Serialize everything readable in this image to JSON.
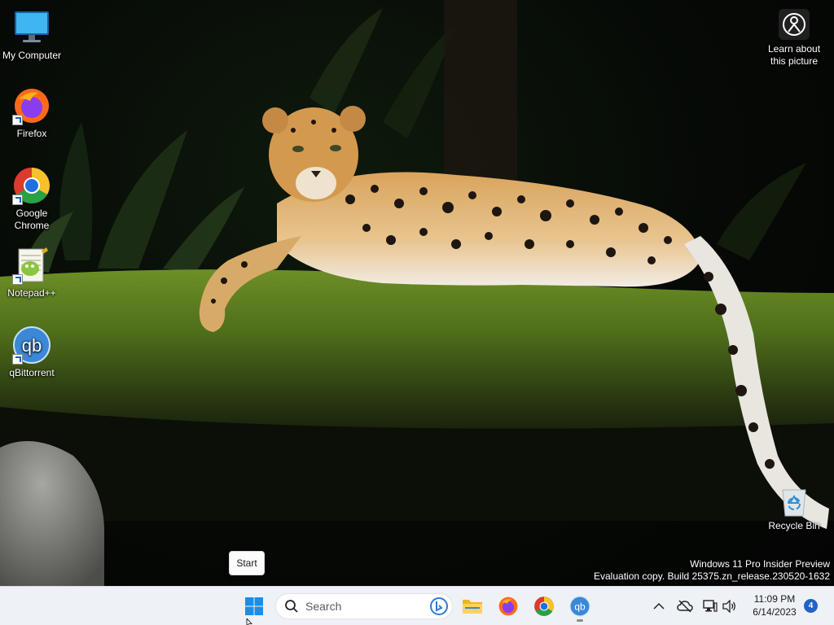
{
  "desktop": {
    "icons": [
      {
        "label": "My Computer",
        "icon": "monitor-icon"
      },
      {
        "label": "Firefox",
        "icon": "firefox-icon"
      },
      {
        "label": "Google Chrome",
        "icon": "chrome-icon"
      },
      {
        "label": "Notepad++",
        "icon": "notepadpp-icon"
      },
      {
        "label": "qBittorrent",
        "icon": "qbittorrent-icon"
      }
    ],
    "spotlight_label": "Learn about this picture",
    "recycle_bin_label": "Recycle Bin",
    "qb_glyph": "qb"
  },
  "watermark": {
    "line1": "Windows 11 Pro Insider Preview",
    "line2": "Evaluation copy. Build 25375.zn_release.230520-1632"
  },
  "tooltip": {
    "text": "Start"
  },
  "taskbar": {
    "search_placeholder": "Search",
    "pinned": [
      {
        "name": "start",
        "icon": "windows-logo-icon"
      },
      {
        "name": "file-explorer",
        "icon": "folder-icon"
      },
      {
        "name": "firefox",
        "icon": "firefox-icon"
      },
      {
        "name": "chrome",
        "icon": "chrome-icon"
      },
      {
        "name": "qbittorrent",
        "icon": "qbittorrent-icon"
      }
    ],
    "tray": {
      "time": "11:09 PM",
      "date": "6/14/2023",
      "notification_count": "4"
    }
  },
  "colors": {
    "taskbar_bg": "#eef1f6",
    "accent": "#1e63c7",
    "windows_blue": "#1a8ee8"
  }
}
